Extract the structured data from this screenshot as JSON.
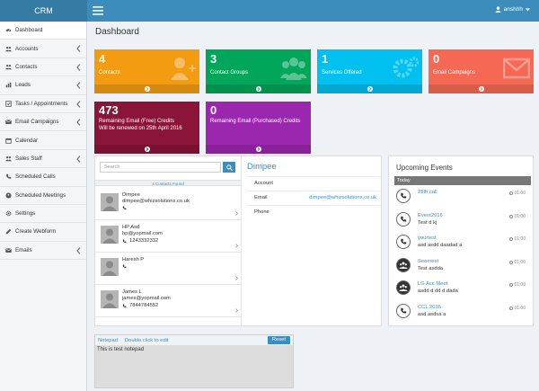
{
  "app": {
    "name": "CRM"
  },
  "header": {
    "user": "anshhh"
  },
  "sidebar": {
    "items": [
      {
        "label": "Dashboard",
        "icon": "dashboard-icon"
      },
      {
        "label": "Accounts",
        "icon": "users-icon"
      },
      {
        "label": "Contacts",
        "icon": "users-icon"
      },
      {
        "label": "Leads",
        "icon": "bars-icon"
      },
      {
        "label": "Tasks / Appointments",
        "icon": "tasks-icon"
      },
      {
        "label": "Email Campaigns",
        "icon": "envelope-icon"
      },
      {
        "label": "Calendar",
        "icon": "calendar-icon"
      },
      {
        "label": "Sales Staff",
        "icon": "users-icon"
      },
      {
        "label": "Scheduled Calls",
        "icon": "phone-icon"
      },
      {
        "label": "Scheduled Meetings",
        "icon": "meeting-icon"
      },
      {
        "label": "Settings",
        "icon": "gear-icon"
      },
      {
        "label": "Create Webform",
        "icon": "edit-icon"
      },
      {
        "label": "Emails",
        "icon": "envelope-icon"
      }
    ]
  },
  "page": {
    "title": "Dashboard"
  },
  "tiles": [
    {
      "value": "4",
      "label": "Contacts",
      "color": "#f39c12"
    },
    {
      "value": "3",
      "label": "Contact Groups",
      "color": "#00a65a"
    },
    {
      "value": "1",
      "label": "Services Offered",
      "color": "#00c0ef"
    },
    {
      "value": "0",
      "label": "Email Campaigns",
      "color": "#f56954"
    },
    {
      "value": "473",
      "label": "Remaining Email (Free) Credits",
      "sub": "Will be renewed on 25th April 2016",
      "color": "#8a1538"
    },
    {
      "value": "0",
      "label": "Remaining Email (Purchased) Credits",
      "color": "#9b27af"
    }
  ],
  "contacts": {
    "search_placeholder": "Search",
    "found_label": "4 Contacts Found",
    "list": [
      {
        "name": "Dimpee",
        "email": "dimpee@whizsolutions.co.uk",
        "phone": ""
      },
      {
        "name": "HP Asd",
        "email": "hp@yopmail.com",
        "phone": "1243332332"
      },
      {
        "name": "Haresh P",
        "email": "",
        "phone": ""
      },
      {
        "name": "James L",
        "email": "james@yopmail.com",
        "phone": "7844784552"
      }
    ]
  },
  "details": {
    "name": "Dimpee",
    "rows": [
      {
        "label": "Account",
        "value": ""
      },
      {
        "label": "Email",
        "value": "dimpee@whizsolutions.co.uk"
      },
      {
        "label": "Phone",
        "value": ""
      }
    ]
  },
  "events": {
    "title": "Upcoming Events",
    "today_label": "Today",
    "items": [
      {
        "title": "25th call",
        "desc": "",
        "time": "01:00",
        "kind": "call"
      },
      {
        "title": "Event2016",
        "desc": "Test d kj",
        "time": "01:00",
        "kind": "call"
      },
      {
        "title": "yourtest",
        "desc": "asd asdd daadad a",
        "time": "01:00",
        "kind": "call"
      },
      {
        "title": "Seomeet",
        "desc": "Test asdda",
        "time": "01:00",
        "kind": "meeting"
      },
      {
        "title": "LG Acc Meet",
        "desc": "asdd d dd d dada",
        "time": "01:00",
        "kind": "meeting"
      },
      {
        "title": "CCL 2016",
        "desc": "asd asdsa a",
        "time": "01:00",
        "kind": "call"
      }
    ]
  },
  "notepad": {
    "title": "Notepad",
    "hint": "Double click to edit",
    "reset_label": "Reset",
    "content": "This is test  notepad"
  }
}
